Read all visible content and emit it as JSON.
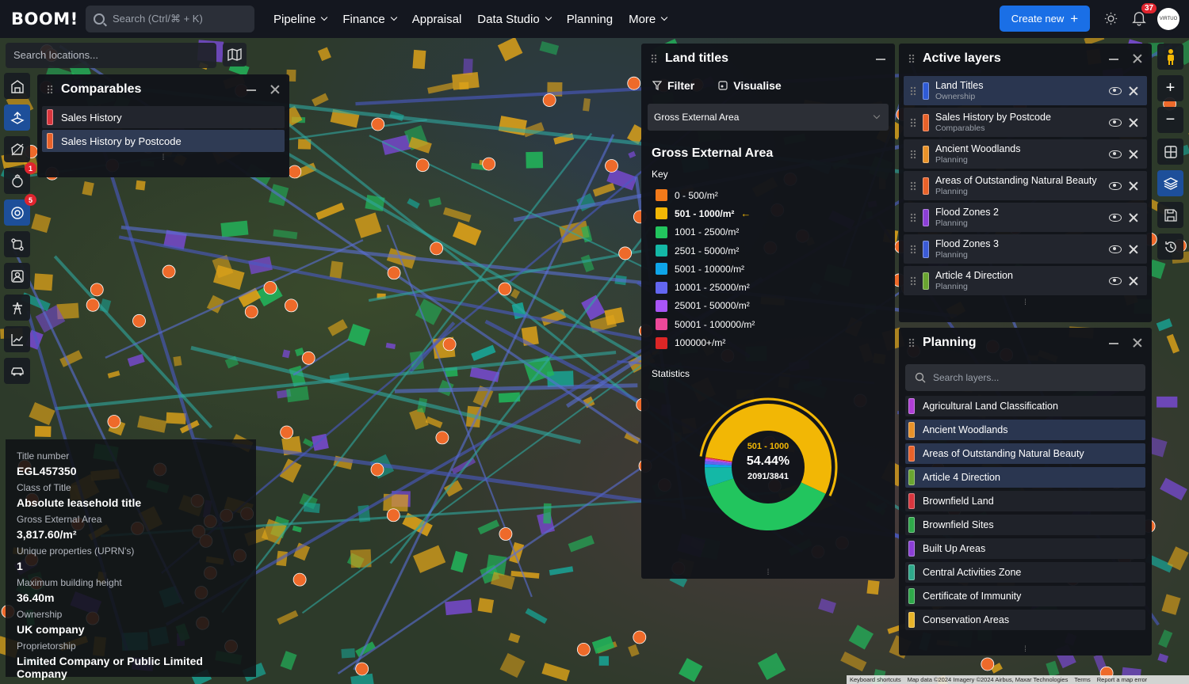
{
  "app": {
    "logo": "BOOM!"
  },
  "topbar": {
    "search_placeholder": "Search (Ctrl/⌘ + K)",
    "nav": [
      {
        "label": "Pipeline",
        "has_dropdown": true
      },
      {
        "label": "Finance",
        "has_dropdown": true
      },
      {
        "label": "Appraisal",
        "has_dropdown": false
      },
      {
        "label": "Data Studio",
        "has_dropdown": true
      },
      {
        "label": "Planning",
        "has_dropdown": false
      },
      {
        "label": "More",
        "has_dropdown": true
      }
    ],
    "create_label": "Create new",
    "notification_count": "37",
    "avatar_text": "VIRTUO"
  },
  "map": {
    "location_placeholder": "Search locations...",
    "tool_badges": {
      "tool4": "1",
      "tool5": "5"
    }
  },
  "comparables": {
    "title": "Comparables",
    "items": [
      {
        "label": "Sales History",
        "color": "#d9363e",
        "selected": false
      },
      {
        "label": "Sales History by Postcode",
        "color": "#e8622a",
        "selected": true
      }
    ]
  },
  "land_titles": {
    "title": "Land titles",
    "filter_label": "Filter",
    "visualise_label": "Visualise",
    "selected_metric": "Gross External Area",
    "heading": "Gross External Area",
    "key_label": "Key",
    "legend": [
      {
        "label": "0 - 500/m²",
        "color": "#f27a1a"
      },
      {
        "label": "501 - 1000/m²",
        "color": "#f2b705",
        "highlight": true
      },
      {
        "label": "1001 - 2500/m²",
        "color": "#22c55e"
      },
      {
        "label": "2501 - 5000/m²",
        "color": "#14b8a6"
      },
      {
        "label": "5001 - 10000/m²",
        "color": "#0ea5e9"
      },
      {
        "label": "10001 - 25000/m²",
        "color": "#6366f1"
      },
      {
        "label": "25001 - 50000/m²",
        "color": "#a855f7"
      },
      {
        "label": "50001 - 100000/m²",
        "color": "#ec4899"
      },
      {
        "label": "100000+/m²",
        "color": "#dc2626"
      }
    ],
    "statistics_label": "Statistics",
    "donut": {
      "range": "501 - 1000",
      "percent": "54.44%",
      "count": "2091/3841",
      "slices": [
        {
          "label": "501 - 1000/m²",
          "value": 54.44,
          "color": "#f2b705"
        },
        {
          "label": "1001 - 2500/m²",
          "value": 38.0,
          "color": "#22c55e"
        },
        {
          "label": "2501 - 5000/m²",
          "value": 5.0,
          "color": "#14b8a6"
        },
        {
          "label": "5001 - 10000/m²",
          "value": 0.8,
          "color": "#0ea5e9"
        },
        {
          "label": "10001 - 25000/m²",
          "value": 0.8,
          "color": "#6366f1"
        },
        {
          "label": "25001 - 50000/m²",
          "value": 0.5,
          "color": "#a855f7"
        },
        {
          "label": "50001 - 100000/m²",
          "value": 0.3,
          "color": "#ec4899"
        },
        {
          "label": "100000+/m²",
          "value": 0.16,
          "color": "#dc2626"
        }
      ]
    }
  },
  "active_layers": {
    "title": "Active layers",
    "items": [
      {
        "name": "Land Titles",
        "sub": "Ownership",
        "color": "#2f5bd6",
        "selected": true
      },
      {
        "name": "Sales History by Postcode",
        "sub": "Comparables",
        "color": "#e8622a",
        "selected": false
      },
      {
        "name": "Ancient Woodlands",
        "sub": "Planning",
        "color": "#e8922a",
        "selected": false
      },
      {
        "name": "Areas of Outstanding Natural Beauty",
        "sub": "Planning",
        "color": "#e8622a",
        "selected": false
      },
      {
        "name": "Flood Zones 2",
        "sub": "Planning",
        "color": "#8b3fd6",
        "selected": false
      },
      {
        "name": "Flood Zones 3",
        "sub": "Planning",
        "color": "#3b5bd6",
        "selected": false
      },
      {
        "name": "Article 4 Direction",
        "sub": "Planning",
        "color": "#6aa531",
        "selected": false
      }
    ]
  },
  "planning": {
    "title": "Planning",
    "search_placeholder": "Search layers...",
    "items": [
      {
        "label": "Agricultural Land Classification",
        "color": "#b03fd6",
        "selected": false
      },
      {
        "label": "Ancient Woodlands",
        "color": "#e8922a",
        "selected": true
      },
      {
        "label": "Areas of Outstanding Natural Beauty",
        "color": "#e8622a",
        "selected": true
      },
      {
        "label": "Article 4 Direction",
        "color": "#6aa531",
        "selected": true
      },
      {
        "label": "Brownfield Land",
        "color": "#d9363e",
        "selected": false
      },
      {
        "label": "Brownfield Sites",
        "color": "#2fa84a",
        "selected": false
      },
      {
        "label": "Built Up Areas",
        "color": "#8b3fd6",
        "selected": false
      },
      {
        "label": "Central Activities Zone",
        "color": "#2fa88a",
        "selected": false
      },
      {
        "label": "Certificate of Immunity",
        "color": "#2fa84a",
        "selected": false
      },
      {
        "label": "Conservation Areas",
        "color": "#e8b42a",
        "selected": false
      }
    ]
  },
  "info_card": {
    "fields": [
      {
        "label": "Title number",
        "value": "EGL457350"
      },
      {
        "label": "Class of Title",
        "value": "Absolute leasehold title"
      },
      {
        "label": "Gross External Area",
        "value": "3,817.60/m²"
      },
      {
        "label": "Unique properties (UPRN's)",
        "value": "1"
      },
      {
        "label": "Maximum building height",
        "value": "36.40m"
      },
      {
        "label": "Ownership",
        "value": "UK company"
      },
      {
        "label": "Proprietorship",
        "value": "Limited Company or Public Limited Company"
      }
    ]
  },
  "attribution": {
    "shortcuts": "Keyboard shortcuts",
    "map_data": "Map data ©2024 Imagery ©2024 Airbus, Maxar Technologies",
    "terms": "Terms",
    "report": "Report a map error"
  }
}
